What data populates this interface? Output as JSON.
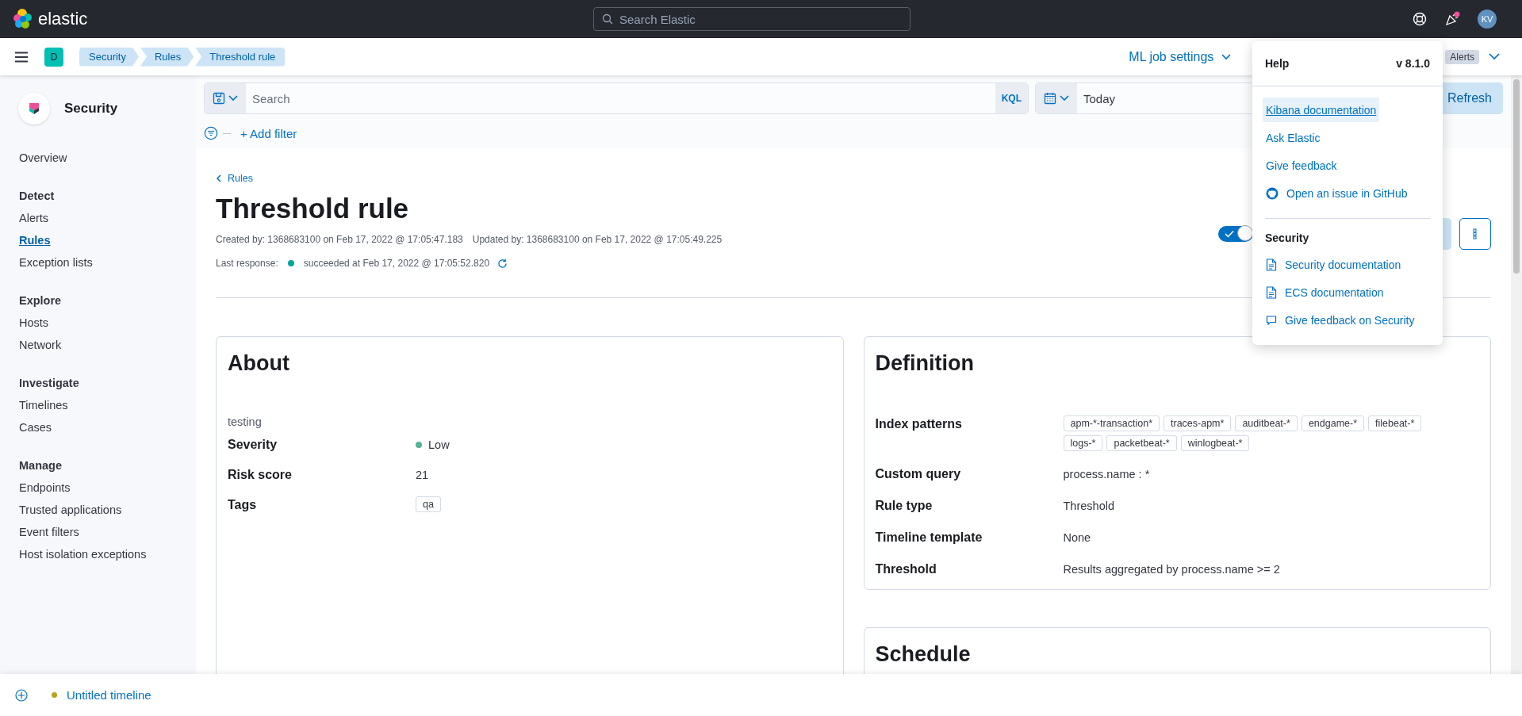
{
  "header": {
    "logo_text": "elastic",
    "search": {
      "placeholder": "Search Elastic"
    },
    "news_unread": true,
    "avatar": "KV"
  },
  "nav": {
    "space": "D",
    "breadcrumbs": [
      "Security",
      "Rules",
      "Threshold rule"
    ],
    "ml_job_settings": "ML job settings",
    "alerts_tag": "Alerts"
  },
  "sidebar": {
    "title": "Security",
    "sections": [
      {
        "items": [
          {
            "label": "Overview",
            "selected": false
          }
        ]
      },
      {
        "heading": "Detect",
        "items": [
          {
            "label": "Alerts",
            "selected": false
          },
          {
            "label": "Rules",
            "selected": true
          },
          {
            "label": "Exception lists",
            "selected": false
          }
        ]
      },
      {
        "heading": "Explore",
        "items": [
          {
            "label": "Hosts",
            "selected": false
          },
          {
            "label": "Network",
            "selected": false
          }
        ]
      },
      {
        "heading": "Investigate",
        "items": [
          {
            "label": "Timelines",
            "selected": false
          },
          {
            "label": "Cases",
            "selected": false
          }
        ]
      },
      {
        "heading": "Manage",
        "items": [
          {
            "label": "Endpoints",
            "selected": false
          },
          {
            "label": "Trusted applications",
            "selected": false
          },
          {
            "label": "Event filters",
            "selected": false
          },
          {
            "label": "Host isolation exceptions",
            "selected": false
          }
        ]
      }
    ]
  },
  "query_bar": {
    "search": {
      "placeholder": "Search"
    },
    "language": "KQL",
    "date": "Today",
    "refresh": "Refresh",
    "add_filter": "+ Add filter"
  },
  "rule": {
    "back_link": "Rules",
    "title": "Threshold rule",
    "created": "Created by: 1368683100 on Feb 17, 2022 @ 17:05:47.183",
    "updated": "Updated by: 1368683100 on Feb 17, 2022 @ 17:05:49.225",
    "last_response_label": "Last response:",
    "last_response": "succeeded at Feb 17, 2022 @ 17:05:52.820",
    "enabled": true
  },
  "about": {
    "title": "About",
    "description": "testing",
    "fields": [
      {
        "kind": "severity",
        "label": "Severity",
        "value": "Low",
        "color": "#54b399"
      },
      {
        "kind": "text",
        "label": "Risk score",
        "value": "21"
      },
      {
        "kind": "tags",
        "label": "Tags",
        "tags": [
          "qa"
        ]
      }
    ]
  },
  "definition": {
    "title": "Definition",
    "fields": [
      {
        "kind": "tags",
        "label": "Index patterns",
        "tags": [
          "apm-*-transaction*",
          "traces-apm*",
          "auditbeat-*",
          "endgame-*",
          "filebeat-*",
          "logs-*",
          "packetbeat-*",
          "winlogbeat-*"
        ]
      },
      {
        "kind": "text",
        "label": "Custom query",
        "value": "process.name : *"
      },
      {
        "kind": "text",
        "label": "Rule type",
        "value": "Threshold"
      },
      {
        "kind": "text",
        "label": "Timeline template",
        "value": "None"
      },
      {
        "kind": "text",
        "label": "Threshold",
        "value": "Results aggregated by process.name >= 2"
      }
    ]
  },
  "schedule": {
    "title": "Schedule"
  },
  "help_popover": {
    "title": "Help",
    "version": "v 8.1.0",
    "links": [
      {
        "label": "Kibana documentation",
        "selected": true
      },
      {
        "label": "Ask Elastic",
        "selected": false
      },
      {
        "label": "Give feedback",
        "selected": false
      },
      {
        "label": "Open an issue in GitHub",
        "kind": "github",
        "selected": false
      }
    ],
    "section_title": "Security",
    "section_links": [
      {
        "label": "Security documentation",
        "kind": "document"
      },
      {
        "label": "ECS documentation",
        "kind": "document"
      },
      {
        "label": "Give feedback on Security",
        "kind": "chat"
      }
    ]
  },
  "timeline": {
    "title": "Untitled timeline",
    "color": "#b9a31f"
  }
}
